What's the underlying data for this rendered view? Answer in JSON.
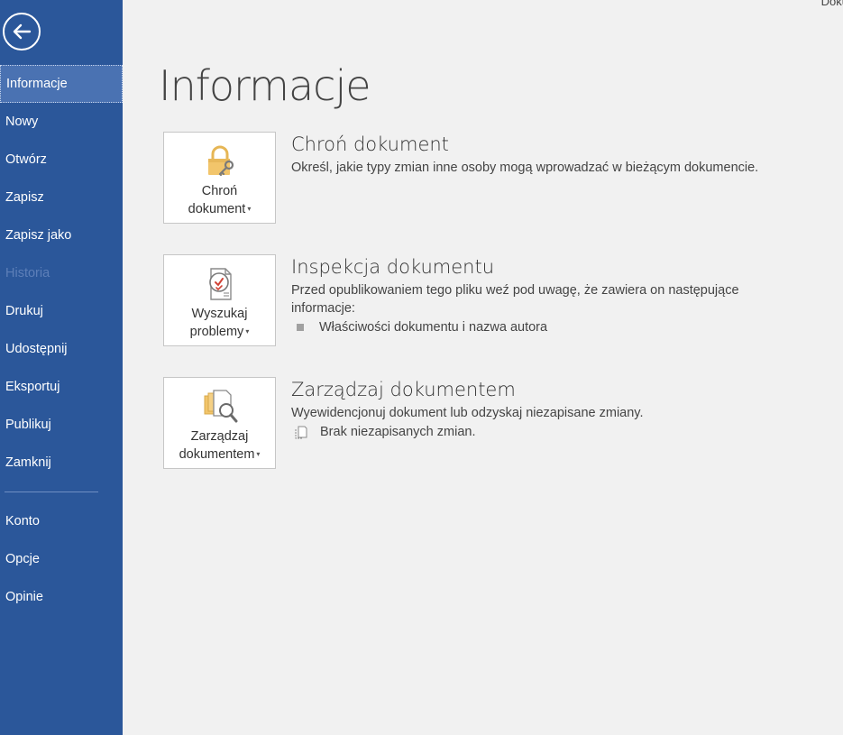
{
  "window": {
    "title_fragment": "Doku"
  },
  "sidebar": {
    "back_label": "Wstecz",
    "items": [
      {
        "label": "Informacje",
        "active": true
      },
      {
        "label": "Nowy"
      },
      {
        "label": "Otwórz"
      },
      {
        "label": "Zapisz"
      },
      {
        "label": "Zapisz jako"
      },
      {
        "label": "Historia",
        "disabled": true
      },
      {
        "label": "Drukuj"
      },
      {
        "label": "Udostępnij"
      },
      {
        "label": "Eksportuj"
      },
      {
        "label": "Publikuj"
      },
      {
        "label": "Zamknij"
      }
    ],
    "bottom_items": [
      {
        "label": "Konto"
      },
      {
        "label": "Opcje"
      },
      {
        "label": "Opinie"
      }
    ],
    "colors": {
      "background": "#2b579a",
      "active": "#4a72b2",
      "disabled_text": "#5d7fb8"
    }
  },
  "main": {
    "title": "Informacje",
    "sections": [
      {
        "tile_line1": "Chroń",
        "tile_line2": "dokument",
        "icon": "lock-key-icon",
        "title": "Chroń dokument",
        "description": "Określ, jakie typy zmian inne osoby mogą wprowadzać w bieżącym dokumencie."
      },
      {
        "tile_line1": "Wyszukaj",
        "tile_line2": "problemy",
        "icon": "inspect-document-icon",
        "title": "Inspekcja dokumentu",
        "description": "Przed opublikowaniem tego pliku weź pod uwagę, że zawiera on następujące informacje:",
        "bullet": "Właściwości dokumentu i nazwa autora"
      },
      {
        "tile_line1": "Zarządzaj",
        "tile_line2": "dokumentem",
        "icon": "manage-document-icon",
        "title": "Zarządzaj dokumentem",
        "description": "Wyewidencjonuj dokument lub odzyskaj niezapisane zmiany.",
        "bullet": "Brak niezapisanych zmian."
      }
    ]
  }
}
